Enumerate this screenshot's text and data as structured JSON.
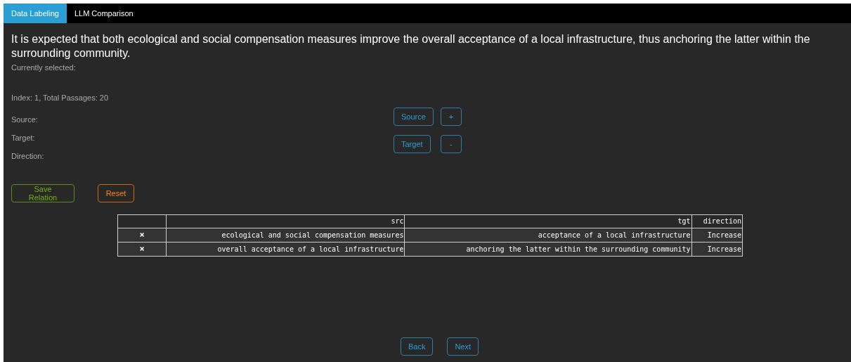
{
  "tabs": [
    {
      "label": "Data Labeling",
      "selected": true
    },
    {
      "label": "LLM Comparison",
      "selected": false
    }
  ],
  "passage": "It is expected that both ecological and social compensation measures improve the overall acceptance of a local infrastructure, thus anchoring the latter within the surrounding community.",
  "currently_selected": "Currently selected:",
  "index_info": "Index: 1, Total Passages: 20",
  "fields": [
    "Source:",
    "Target:",
    "Direction:"
  ],
  "selector_buttons": [
    [
      "Source",
      "+"
    ],
    [
      "Target",
      "-"
    ]
  ],
  "action_buttons": [
    {
      "label": "Save Relation",
      "kind": "save"
    },
    {
      "label": "Reset",
      "kind": "reset"
    }
  ],
  "table": {
    "columns": [
      "src",
      "tgt",
      "direction"
    ],
    "rows": [
      {
        "delete": "×",
        "src": "ecological and social compensation measures",
        "tgt": "acceptance of a local infrastructure",
        "direction": "Increase"
      },
      {
        "delete": "×",
        "src": "overall acceptance of a local infrastructure",
        "tgt": "anchoring the latter within the surrounding community",
        "direction": "Increase"
      }
    ]
  },
  "nav_buttons": [
    "Back",
    "Next"
  ]
}
